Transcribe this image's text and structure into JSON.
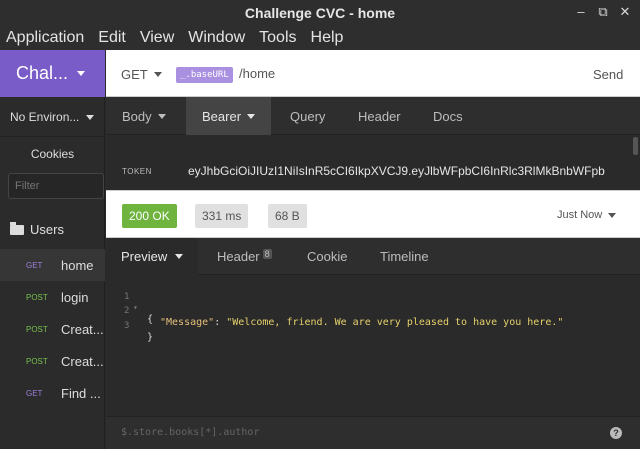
{
  "window": {
    "title": "Challenge CVC - home",
    "controls": [
      "minimize-icon",
      "maximize-icon",
      "close-icon"
    ]
  },
  "menu": [
    "Application",
    "Edit",
    "View",
    "Window",
    "Tools",
    "Help"
  ],
  "sidebar": {
    "workspace": "Chal...",
    "environment": "No Environ...",
    "cookies": "Cookies",
    "filter_placeholder": "Filter",
    "folder": "Users",
    "requests": [
      {
        "method": "GET",
        "name": "home",
        "active": true
      },
      {
        "method": "POST",
        "name": "login",
        "active": false
      },
      {
        "method": "POST",
        "name": "Creat...",
        "active": false
      },
      {
        "method": "POST",
        "name": "Creat...",
        "active": false
      },
      {
        "method": "GET",
        "name": "Find ...",
        "active": false
      }
    ]
  },
  "request": {
    "method": "GET",
    "base_tag": "_.baseURL",
    "path": "/home",
    "send_label": "Send",
    "tabs": {
      "body": "Body",
      "auth": "Bearer",
      "query": "Query",
      "header": "Header",
      "docs": "Docs"
    },
    "token_label": "TOKEN",
    "token_value": "eyJhbGciOiJIUzI1NiIsInR5cCI6IkpXVCJ9.eyJlbWFpbCI6InRlc3RlMkBnbWFpb"
  },
  "response": {
    "status": "200 OK",
    "time": "331 ms",
    "size": "68 B",
    "when": "Just Now",
    "tabs": {
      "preview": "Preview",
      "header": "Header",
      "header_count": "8",
      "cookie": "Cookie",
      "timeline": "Timeline"
    },
    "lines": [
      {
        "no": "1",
        "text": "{"
      },
      {
        "no": "2",
        "key": "\"Message\"",
        "sep": ": ",
        "value": "\"Welcome, friend. We are very pleased to have you here.\""
      },
      {
        "no": "3",
        "text": "}"
      }
    ],
    "filter_placeholder": "$.store.books[*].author",
    "help": "?"
  },
  "colors": {
    "workspace_accent": "#7a5cc8",
    "get": "#9c7fdb",
    "post": "#76c04d",
    "status_ok": "#6eb43f"
  }
}
